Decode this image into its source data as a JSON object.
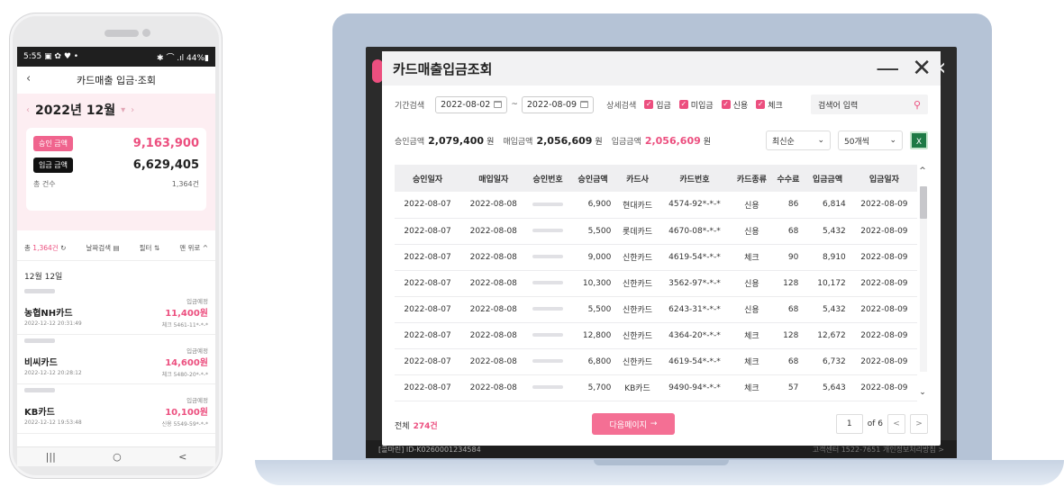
{
  "phone": {
    "status": {
      "time": "5:55 ▣ ✿ ♥ •",
      "right": "✱ ⌒ .ıl 44%▮"
    },
    "title": "카드매출 입금·조회",
    "month": "2022년 12월",
    "summary": {
      "approved_label": "승인 금액",
      "approved_value": "9,163,900",
      "deposit_label": "입금 금액",
      "deposit_value": "6,629,405",
      "count_label": "총 건수",
      "count_value": "1,364건"
    },
    "filter": {
      "total_prefix": "총 ",
      "total_count": "1,364건",
      "refresh": "↻",
      "date_search": "날짜검색",
      "filter": "필터",
      "top": "맨 위로"
    },
    "day_header": "12월 12일",
    "transactions": [
      {
        "status": "입금예정",
        "name": "농협NH카드",
        "amount": "11,400원",
        "datetime": "2022-12-12  20:31:49",
        "card": "체크 5461-11*-*-*"
      },
      {
        "status": "입금예정",
        "name": "비씨카드",
        "amount": "14,600원",
        "datetime": "2022-12-12  20:28:12",
        "card": "체크 5480-20*-*-*"
      },
      {
        "status": "입금예정",
        "name": "KB카드",
        "amount": "10,100원",
        "datetime": "2022-12-12  19:53:48",
        "card": "신용 5549-59*-*-*"
      }
    ],
    "nav": {
      "recent": "|||",
      "home": "○",
      "back": "<"
    }
  },
  "modal": {
    "title": "카드매출입금조회",
    "minimize": "—",
    "close": "✕",
    "search": {
      "period_label": "기간검색",
      "start_date": "2022-08-02",
      "tilde": "~",
      "end_date": "2022-08-09",
      "detail_label": "상세검색",
      "filters": [
        "입금",
        "미입금",
        "신용",
        "체크"
      ],
      "placeholder": "검색어 입력"
    },
    "totals": {
      "approved_label": "승인금액",
      "approved_value": "2,079,400",
      "purchase_label": "매입금액",
      "purchase_value": "2,056,609",
      "deposit_label": "입금금액",
      "deposit_value": "2,056,609",
      "unit": "원"
    },
    "sort": "최신순",
    "page_size": "50개씩",
    "excel": "X",
    "columns": [
      "승인일자",
      "매입일자",
      "승인번호",
      "승인금액",
      "카드사",
      "카드번호",
      "카드종류",
      "수수료",
      "입금금액",
      "입금일자"
    ],
    "rows": [
      [
        "2022-08-07",
        "2022-08-08",
        "",
        "6,900",
        "현대카드",
        "4574-92*-*-*",
        "신용",
        "86",
        "6,814",
        "2022-08-09"
      ],
      [
        "2022-08-07",
        "2022-08-08",
        "",
        "5,500",
        "롯데카드",
        "4670-08*-*-*",
        "신용",
        "68",
        "5,432",
        "2022-08-09"
      ],
      [
        "2022-08-07",
        "2022-08-08",
        "",
        "9,000",
        "신한카드",
        "4619-54*-*-*",
        "체크",
        "90",
        "8,910",
        "2022-08-09"
      ],
      [
        "2022-08-07",
        "2022-08-08",
        "",
        "10,300",
        "신한카드",
        "3562-97*-*-*",
        "신용",
        "128",
        "10,172",
        "2022-08-09"
      ],
      [
        "2022-08-07",
        "2022-08-08",
        "",
        "5,500",
        "신한카드",
        "6243-31*-*-*",
        "신용",
        "68",
        "5,432",
        "2022-08-09"
      ],
      [
        "2022-08-07",
        "2022-08-08",
        "",
        "12,800",
        "신한카드",
        "4364-20*-*-*",
        "체크",
        "128",
        "12,672",
        "2022-08-09"
      ],
      [
        "2022-08-07",
        "2022-08-08",
        "",
        "6,800",
        "신한카드",
        "4619-54*-*-*",
        "체크",
        "68",
        "6,732",
        "2022-08-09"
      ],
      [
        "2022-08-07",
        "2022-08-08",
        "",
        "5,700",
        "KB카드",
        "9490-94*-*-*",
        "체크",
        "57",
        "5,643",
        "2022-08-09"
      ]
    ],
    "footer": {
      "total_label": "전체",
      "total_value": "274건",
      "next_label": "다음페이지",
      "next_arrow": "→",
      "page": "1",
      "of": "of 6",
      "prev_btn": "<",
      "next_btn": ">"
    }
  },
  "background": {
    "footer_left": "[콜마린] ID-K0260001234584",
    "footer_right": "고객센터 1522-7651   개인정보처리방침 >"
  }
}
